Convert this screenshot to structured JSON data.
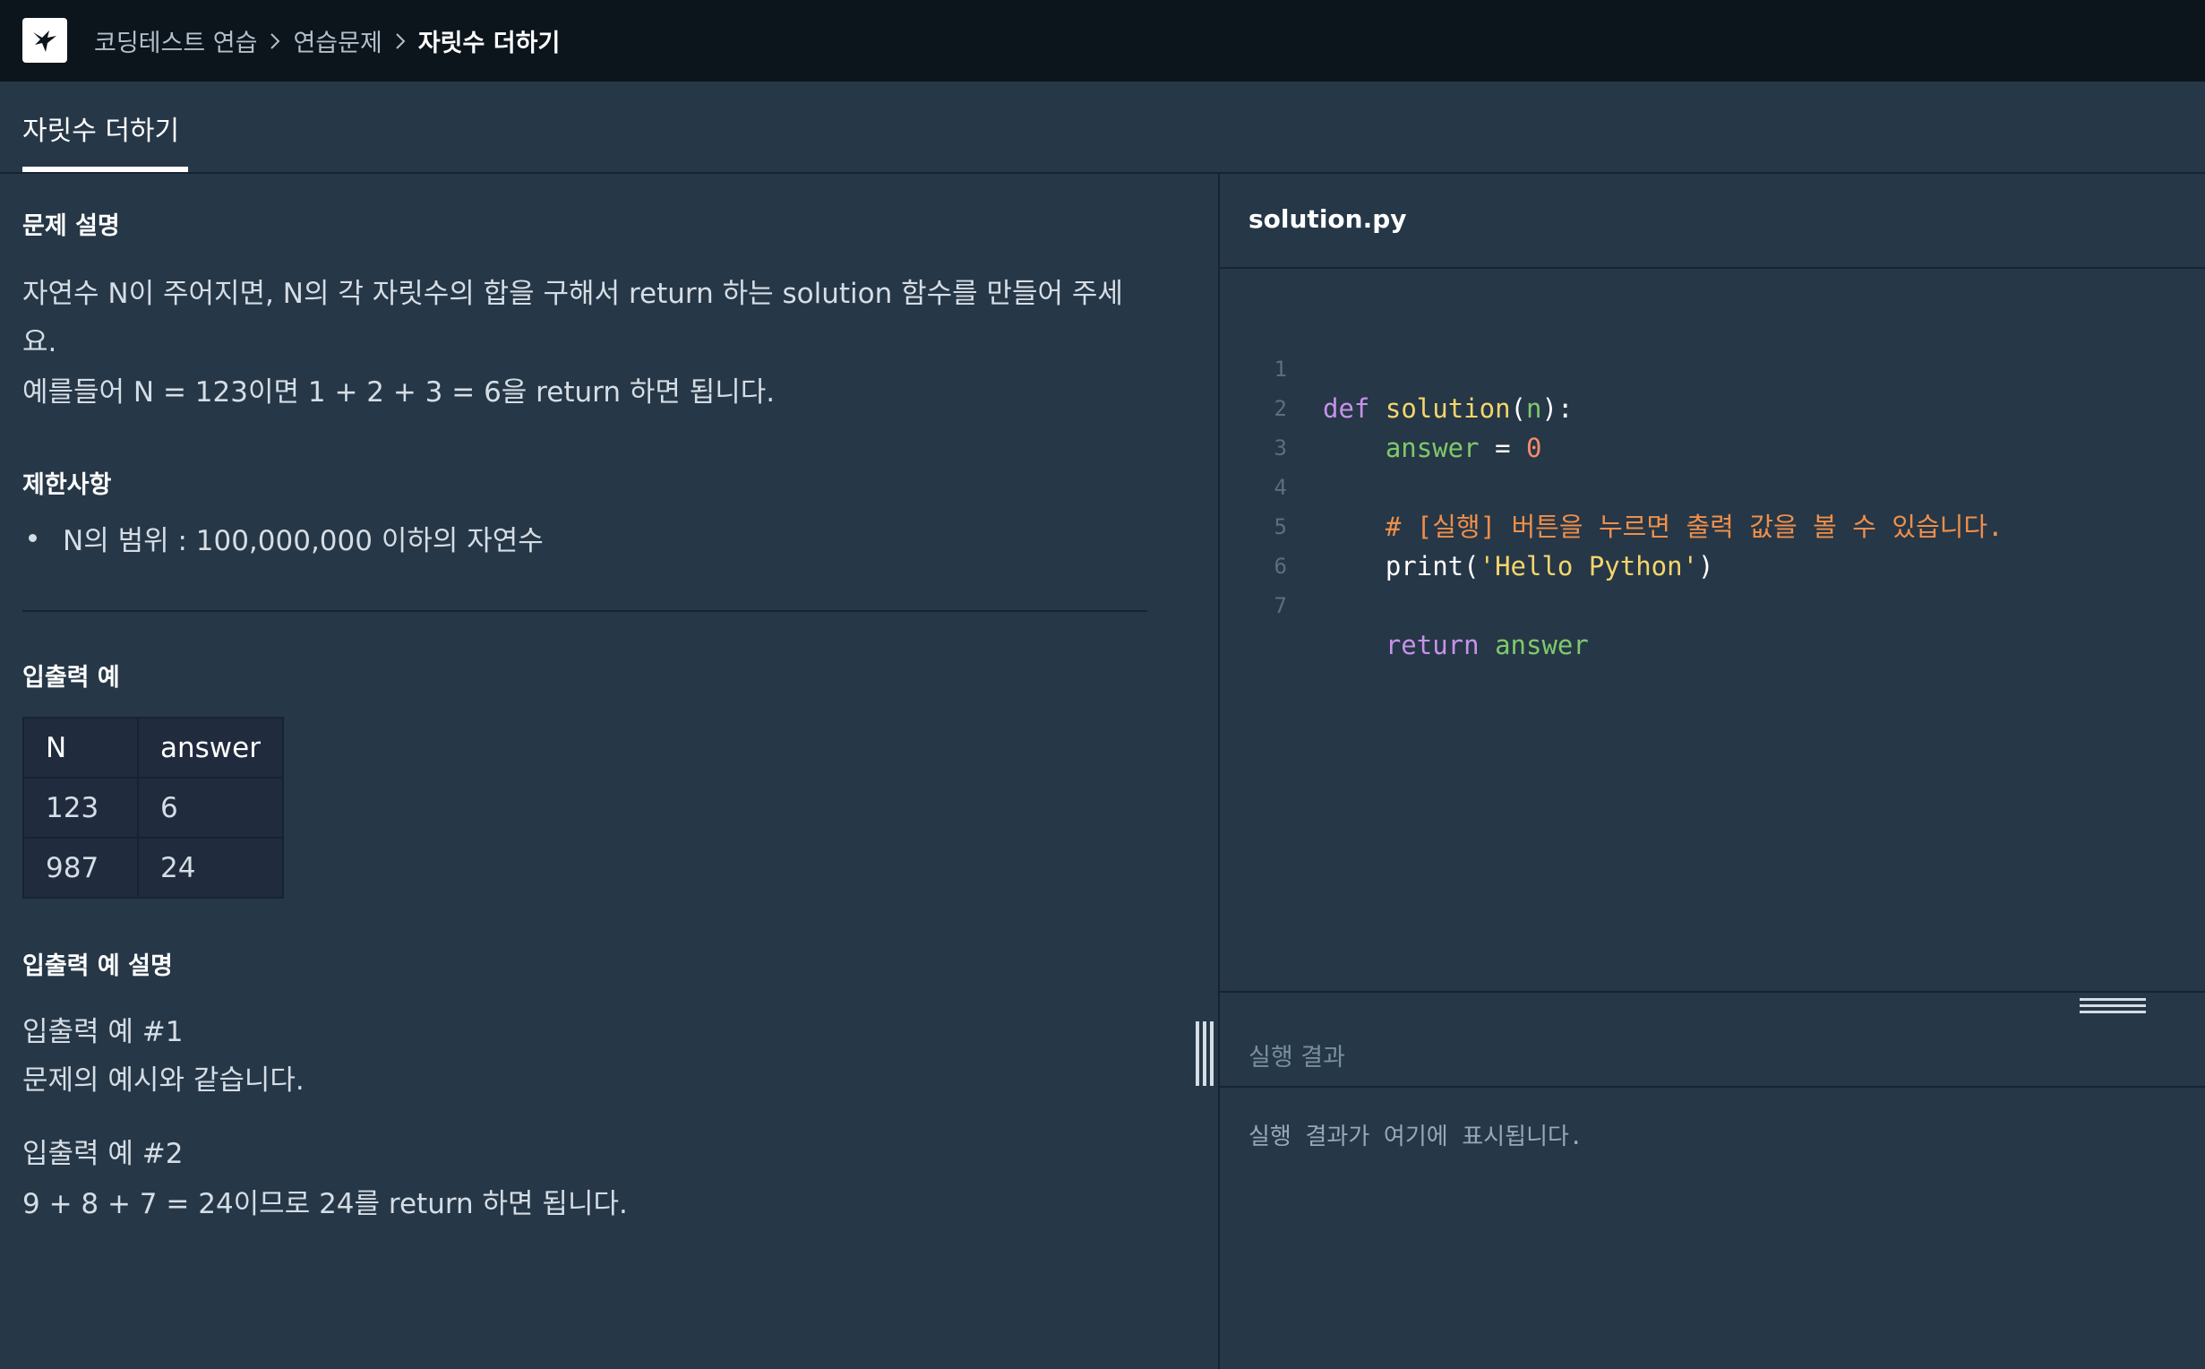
{
  "nav": {
    "crumbs": [
      "코딩테스트 연습",
      "연습문제",
      "자릿수 더하기"
    ]
  },
  "tab": {
    "label": "자릿수 더하기"
  },
  "problem": {
    "desc_title": "문제 설명",
    "desc_line1": "자연수 N이 주어지면, N의 각 자릿수의 합을 구해서 return 하는 solution 함수를 만들어 주세",
    "desc_line2": "요.",
    "desc_line3": "예를들어 N = 123이면 1 + 2 + 3 = 6을 return 하면 됩니다.",
    "constraints_title": "제한사항",
    "constraints": [
      "N의 범위 : 100,000,000 이하의 자연수"
    ],
    "io_title": "입출력 예",
    "io_headers": [
      "N",
      "answer"
    ],
    "io_rows": [
      [
        "123",
        "6"
      ],
      [
        "987",
        "24"
      ]
    ],
    "io_expl_title": "입출력 예 설명",
    "ex1_title": "입출력 예 #1",
    "ex1_body": "문제의 예시와 같습니다.",
    "ex2_title": "입출력 예 #2",
    "ex2_body": "9 + 8 + 7 = 24이므로 24를 return 하면 됩니다."
  },
  "editor": {
    "file_name": "solution.py",
    "line_numbers": [
      "1",
      "2",
      "3",
      "4",
      "5",
      "6",
      "7"
    ],
    "tokens": {
      "def": "def",
      "fn_name": "solution",
      "open_paren": "(",
      "param": "n",
      "close_colon": "):",
      "answer_var": "answer",
      "assign": " = ",
      "zero": "0",
      "comment": "# [실행] 버튼을 누르면 출력 값을 볼 수 있습니다.",
      "print_fn": "print(",
      "print_str": "'Hello Python'",
      "print_close": ")",
      "return_kw": "return",
      "return_var": "answer"
    }
  },
  "result": {
    "label": "실행 결과",
    "placeholder": "실행 결과가 여기에 표시됩니다."
  },
  "colors": {
    "background": "#263747",
    "topbar": "#0c151c",
    "keyword": "#c792ea",
    "function": "#f5d66b",
    "variable": "#7fc96b",
    "number": "#f78c6c",
    "comment": "#ef8f4a"
  }
}
